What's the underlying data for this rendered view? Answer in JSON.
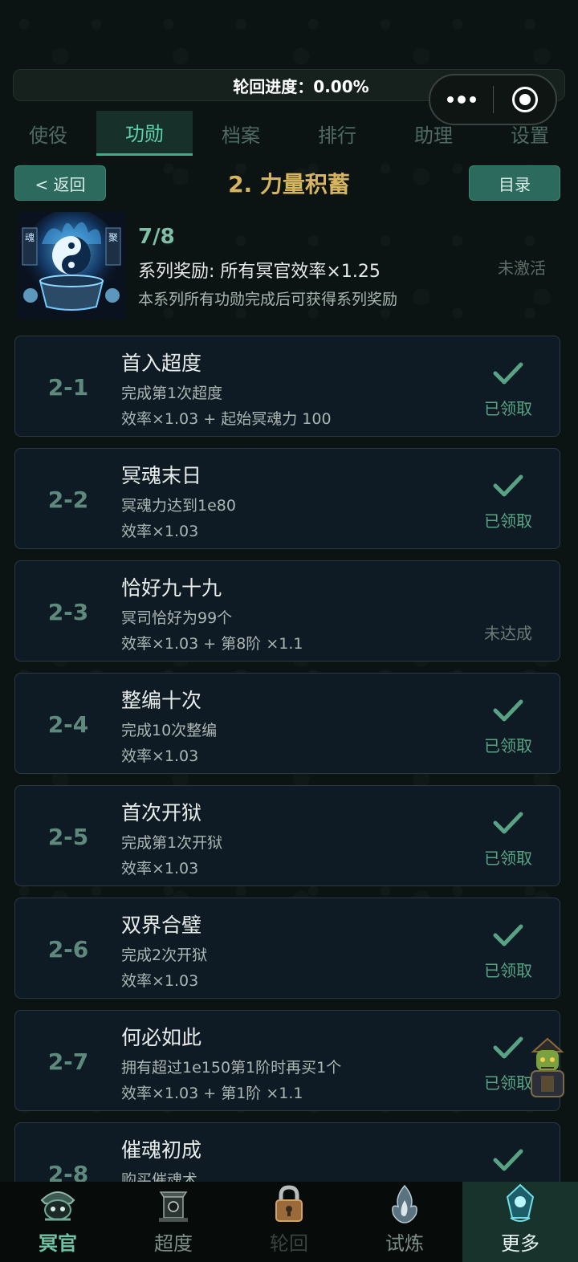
{
  "progress": {
    "text": "轮回进度：0.00%",
    "value": 0.0
  },
  "tabs": [
    {
      "label": "使役",
      "active": false
    },
    {
      "label": "功勋",
      "active": true
    },
    {
      "label": "档案",
      "active": false
    },
    {
      "label": "排行",
      "active": false
    },
    {
      "label": "助理",
      "active": false
    },
    {
      "label": "设置",
      "active": false
    }
  ],
  "header": {
    "back_label": "< 返回",
    "title": "2. 力量积蓄",
    "menu_label": "目录"
  },
  "series": {
    "count": "7/8",
    "reward": "系列奖励: 所有冥官效率×1.25",
    "desc": "本系列所有功勋完成后可获得系列奖励",
    "status": "未激活",
    "image_icon": "yin-yang-cauldron-icon",
    "banner_left": "魂",
    "banner_right": "聚"
  },
  "achievements": [
    {
      "id": "2-1",
      "name": "首入超度",
      "req": "完成第1次超度",
      "bonus": "效率×1.03 + 起始冥魂力 100",
      "status": "已领取",
      "claimed": true
    },
    {
      "id": "2-2",
      "name": "冥魂末日",
      "req": "冥魂力达到1e80",
      "bonus": "效率×1.03",
      "status": "已领取",
      "claimed": true
    },
    {
      "id": "2-3",
      "name": "恰好九十九",
      "req": "冥司恰好为99个",
      "bonus": "效率×1.03 + 第8阶 ×1.1",
      "status": "未达成",
      "claimed": false
    },
    {
      "id": "2-4",
      "name": "整编十次",
      "req": "完成10次整编",
      "bonus": "效率×1.03",
      "status": "已领取",
      "claimed": true
    },
    {
      "id": "2-5",
      "name": "首次开狱",
      "req": "完成第1次开狱",
      "bonus": "效率×1.03",
      "status": "已领取",
      "claimed": true
    },
    {
      "id": "2-6",
      "name": "双界合璧",
      "req": "完成2次开狱",
      "bonus": "效率×1.03",
      "status": "已领取",
      "claimed": true
    },
    {
      "id": "2-7",
      "name": "何必如此",
      "req": "拥有超过1e150第1阶时再买1个",
      "bonus": "效率×1.03 + 第1阶 ×1.1",
      "status": "已领取",
      "claimed": true
    },
    {
      "id": "2-8",
      "name": "催魂初成",
      "req": "购买催魂术",
      "bonus": "",
      "status": "",
      "claimed": true
    }
  ],
  "bottom_nav": [
    {
      "label": "冥官",
      "icon": "ghost-helmet-icon"
    },
    {
      "label": "超度",
      "icon": "altar-icon"
    },
    {
      "label": "轮回",
      "icon": "lock-icon"
    },
    {
      "label": "试炼",
      "icon": "flame-icon"
    },
    {
      "label": "更多",
      "icon": "spirit-gem-icon"
    }
  ],
  "colors": {
    "accent": "#3fae8b",
    "gold": "#d7b560",
    "claimed": "#58a383"
  }
}
